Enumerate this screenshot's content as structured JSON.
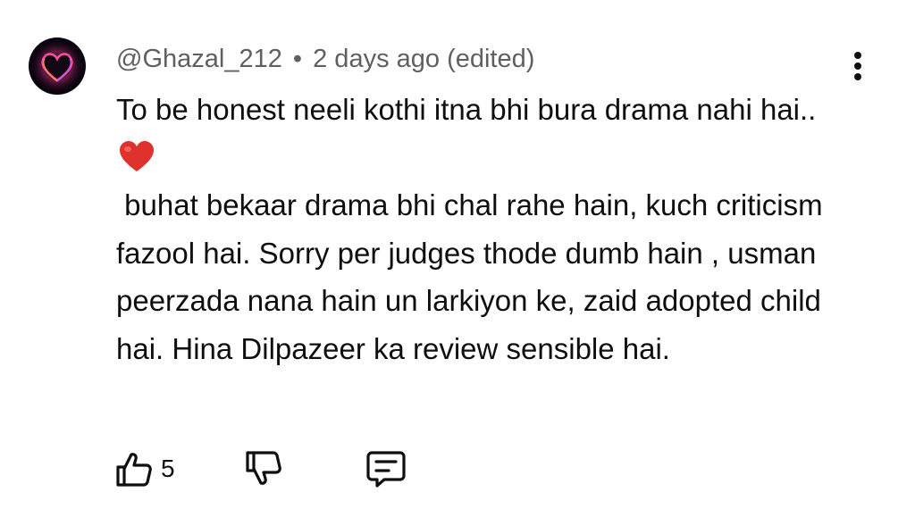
{
  "comment": {
    "handle": "@Ghazal_212",
    "separator": "•",
    "time": "2 days ago (edited)",
    "paragraphs": [
      "To be honest neeli kothi itna bhi bura drama nahi hai..",
      " buhat bekaar drama bhi chal rahe hain, kuch criticism fazool hai. Sorry per judges thode dumb hain , usman peerzada nana hain un larkiyon ke, zaid adopted child hai. Hina Dilpazeer ka review sensible hai."
    ],
    "emoji": "heart-emoji"
  },
  "actions": {
    "like_icon": "thumbs-up-icon",
    "like_count": "5",
    "dislike_icon": "thumbs-down-icon",
    "reply_icon": "reply-comment-icon"
  },
  "menu": {
    "icon": "more-vertical-icon"
  },
  "colors": {
    "text_primary": "#0f0f0f",
    "text_secondary": "#606060",
    "heart": "#e0322c",
    "background": "#ffffff"
  }
}
